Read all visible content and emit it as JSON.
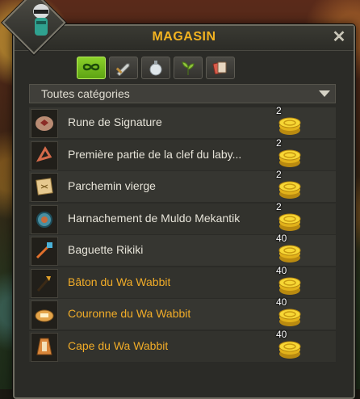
{
  "window": {
    "title": "MAGASIN",
    "close_icon": "close-icon"
  },
  "tabs": [
    {
      "icon": "infinity-icon",
      "active": true
    },
    {
      "icon": "sword-icon",
      "active": false
    },
    {
      "icon": "potion-icon",
      "active": false
    },
    {
      "icon": "plant-icon",
      "active": false
    },
    {
      "icon": "cards-icon",
      "active": false
    }
  ],
  "category_select": {
    "value": "Toutes catégories"
  },
  "items": [
    {
      "name": "Rune de Signature",
      "price": "2",
      "icon": "rune-icon",
      "quest": false
    },
    {
      "name": "Première partie de la clef du laby...",
      "price": "2",
      "icon": "key-fragment-icon",
      "quest": false
    },
    {
      "name": "Parchemin vierge",
      "price": "2",
      "icon": "scroll-icon",
      "quest": false
    },
    {
      "name": "Harnachement de Muldo Mekantik",
      "price": "2",
      "icon": "harness-icon",
      "quest": false
    },
    {
      "name": "Baguette Rikiki",
      "price": "40",
      "icon": "wand-icon",
      "quest": false
    },
    {
      "name": "Bâton du Wa Wabbit",
      "price": "40",
      "icon": "staff-icon",
      "quest": true
    },
    {
      "name": "Couronne du Wa Wabbit",
      "price": "40",
      "icon": "crown-icon",
      "quest": true
    },
    {
      "name": "Cape du Wa Wabbit",
      "price": "40",
      "icon": "cape-icon",
      "quest": true
    }
  ],
  "colors": {
    "accent": "#f2b321",
    "quest_item": "#f1ac28",
    "tab_active": "#7cc11f"
  }
}
